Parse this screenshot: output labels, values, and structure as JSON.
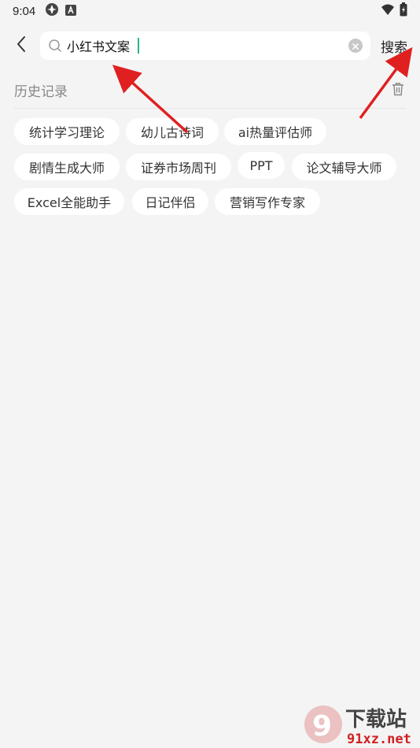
{
  "status_bar": {
    "time": "9:04",
    "left_icons": [
      "app-icon",
      "font-icon"
    ],
    "right_icons": [
      "wifi-icon",
      "battery-icon"
    ]
  },
  "search": {
    "value": "小红书文案",
    "submit_label": "搜索"
  },
  "history": {
    "title": "历史记录",
    "tags": [
      "统计学习理论",
      "幼儿古诗词",
      "ai热量评估师",
      "剧情生成大师",
      "证券市场周刊",
      "PPT",
      "论文辅导大师",
      "Excel全能助手",
      "日记伴侣",
      "营销写作专家"
    ]
  },
  "watermark": {
    "brand": "下载站",
    "domain": "91xz.net",
    "mark": "9"
  },
  "colors": {
    "background": "#f4f4f4",
    "tag_background": "#ffffff",
    "caret": "#2bb48a",
    "annotation_arrow": "#e02020"
  }
}
